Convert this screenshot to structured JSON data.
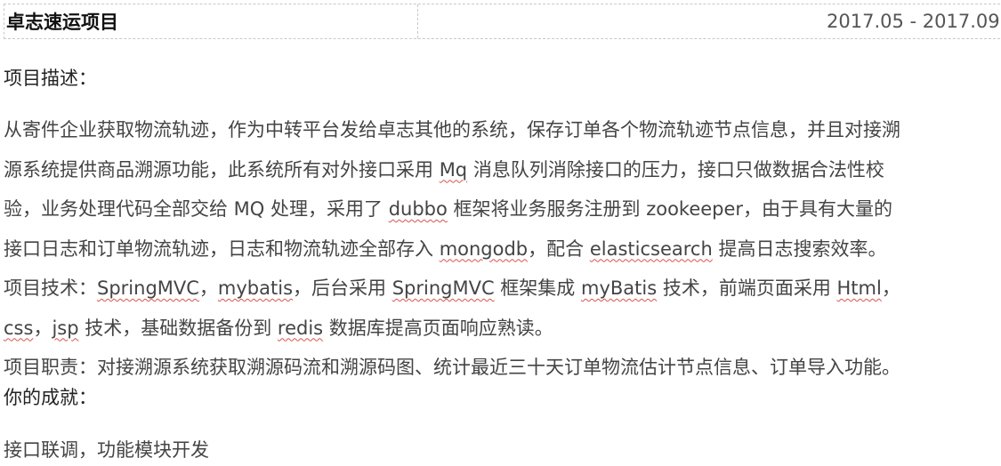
{
  "project": {
    "title": "卓志速运项目",
    "period": "2017.05 - 2017.09"
  },
  "description": {
    "heading": "项目描述：",
    "lines": [
      [
        {
          "t": "从寄件企业获取物流轨迹，作为中转平台发给卓志其他的系统，保存订单各个物流轨迹节点信息，并且对接溯"
        }
      ],
      [
        {
          "t": "源系统提供商品溯源功能，此系统所有对外接口采用 "
        },
        {
          "t": "Mq",
          "sq": true
        },
        {
          "t": " 消息队列消除接口的压力，接口只做数据合法性校"
        }
      ],
      [
        {
          "t": "验，业务处理代码全部交给 MQ 处理，采用了 "
        },
        {
          "t": "dubbo",
          "sq": true
        },
        {
          "t": " 框架将业务服务注册到 zookeeper，由于具有大量的"
        }
      ],
      [
        {
          "t": "接口日志和订单物流轨迹，日志和物流轨迹全部存入 "
        },
        {
          "t": "mongodb",
          "sq": true
        },
        {
          "t": "，配合 "
        },
        {
          "t": "elasticsearch",
          "sq": true
        },
        {
          "t": " 提高日志搜索效率。"
        }
      ],
      [
        {
          "t": "项目技术："
        },
        {
          "t": "SpringMVC",
          "sq": true
        },
        {
          "t": "，"
        },
        {
          "t": "mybatis",
          "sq": true
        },
        {
          "t": "，后台采用 "
        },
        {
          "t": "SpringMVC",
          "sq": true
        },
        {
          "t": " 框架集成 "
        },
        {
          "t": "myBatis",
          "sq": true
        },
        {
          "t": " 技术，前端页面采用 "
        },
        {
          "t": "Html",
          "sq": true
        },
        {
          "t": "，"
        }
      ],
      [
        {
          "t": "css",
          "sq": true
        },
        {
          "t": "，"
        },
        {
          "t": "jsp",
          "sq": true
        },
        {
          "t": " 技术，基础数据备份到 "
        },
        {
          "t": "redis",
          "sq": true
        },
        {
          "t": " 数据库提高页面响应熟读。"
        }
      ],
      [
        {
          "t": "项目职责：对接溯源系统获取溯源码流和溯源码图、统计最近三十天订单物流估计节点信息、订单导入功能。"
        }
      ]
    ]
  },
  "achievement": {
    "heading": "你的成就：",
    "text": "接口联调，功能模块开发"
  }
}
